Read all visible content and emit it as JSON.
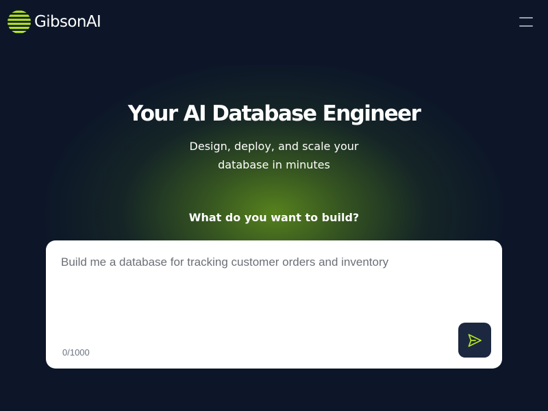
{
  "brand": {
    "name": "GibsonAI",
    "logo_icon": "gibson-striped-globe-icon",
    "accent_color": "#b5e61d"
  },
  "header": {
    "menu_icon": "hamburger-menu-icon"
  },
  "hero": {
    "title": "Your AI Database Engineer",
    "subtitle_line1": "Design, deploy, and scale your",
    "subtitle_line2": "database in minutes"
  },
  "prompt": {
    "label": "What do you want to build?",
    "placeholder": "Build me a database for tracking customer orders and inventory",
    "value": "",
    "char_count": "0/1000",
    "send_icon": "send-arrow-icon"
  },
  "colors": {
    "background": "#0c1628",
    "glow": "#5a871c",
    "card": "#ffffff",
    "send_button": "#1c2840"
  }
}
